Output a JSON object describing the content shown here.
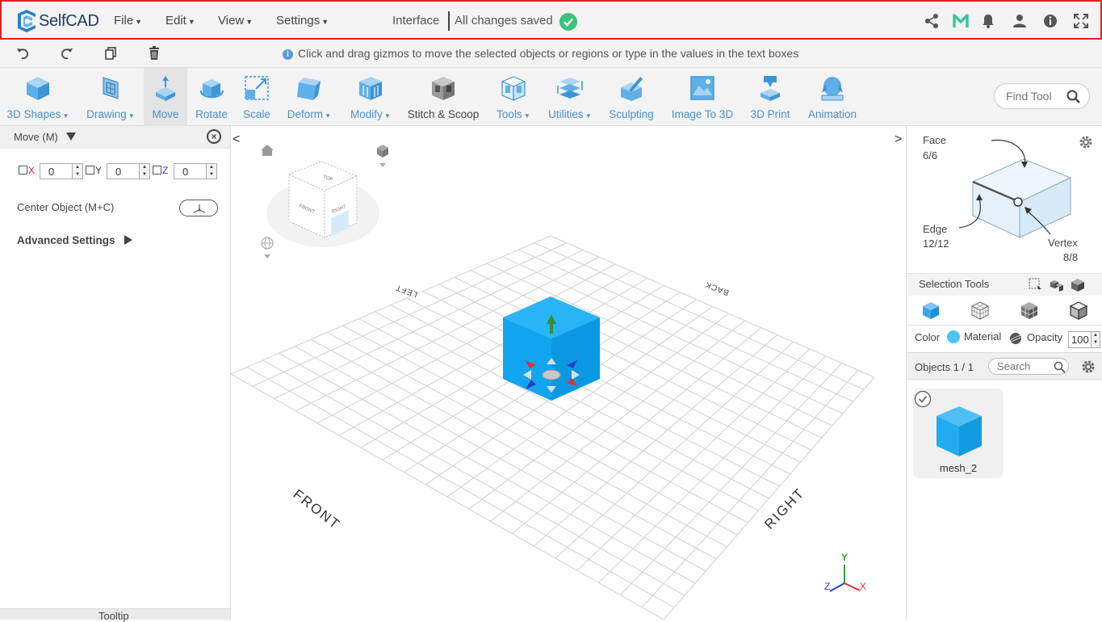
{
  "app": {
    "name": "SelfCAD"
  },
  "menu": [
    {
      "label": "File"
    },
    {
      "label": "Edit"
    },
    {
      "label": "View"
    },
    {
      "label": "Settings"
    }
  ],
  "status": {
    "interface": "Interface",
    "saved": "All changes saved"
  },
  "hint": "Click and drag gizmos to move the selected objects or regions or type in the values in the text boxes",
  "toolbar": {
    "tools": [
      {
        "label": "3D Shapes",
        "caret": true
      },
      {
        "label": "Drawing",
        "caret": true
      },
      {
        "label": "Move",
        "active": true
      },
      {
        "label": "Rotate"
      },
      {
        "label": "Scale"
      },
      {
        "label": "Deform",
        "caret": true
      },
      {
        "label": "Modify",
        "caret": true
      },
      {
        "label": "Stitch & Scoop"
      },
      {
        "label": "Tools",
        "caret": true
      },
      {
        "label": "Utilities",
        "caret": true
      },
      {
        "label": "Sculpting"
      },
      {
        "label": "Image To 3D"
      },
      {
        "label": "3D Print"
      },
      {
        "label": "Animation"
      }
    ],
    "find_placeholder": "Find Tool"
  },
  "left_panel": {
    "title": "Move (M)",
    "x_label": "X",
    "y_label": "Y",
    "z_label": "Z",
    "x_value": "0",
    "y_value": "0",
    "z_value": "0",
    "center_label": "Center Object (M+C)",
    "advanced_label": "Advanced Settings",
    "tooltip_label": "Tooltip"
  },
  "viewport": {
    "cube_labels": {
      "top": "TOP",
      "front": "FRONT",
      "right": "RIGHT"
    },
    "grid_labels": {
      "left": "LEFT",
      "back": "BACK",
      "front": "FRONT",
      "right": "RIGHT"
    },
    "axes": {
      "x": "X",
      "y": "Y",
      "z": "Z"
    }
  },
  "right_panel": {
    "face_label": "Face",
    "face_count": "6/6",
    "edge_label": "Edge",
    "edge_count": "12/12",
    "vertex_label": "Vertex",
    "vertex_count": "8/8",
    "selection_tools_label": "Selection Tools",
    "color_label": "Color",
    "material_label": "Material",
    "opacity_label": "Opacity",
    "opacity_value": "100",
    "objects_label": "Objects 1 / 1",
    "search_placeholder": "Search",
    "object_name": "mesh_2"
  },
  "colors": {
    "accent": "#4a90c8",
    "object_blue": "#1aa8f0",
    "saved_green": "#3cc27a",
    "highlight_red": "#e02020"
  }
}
